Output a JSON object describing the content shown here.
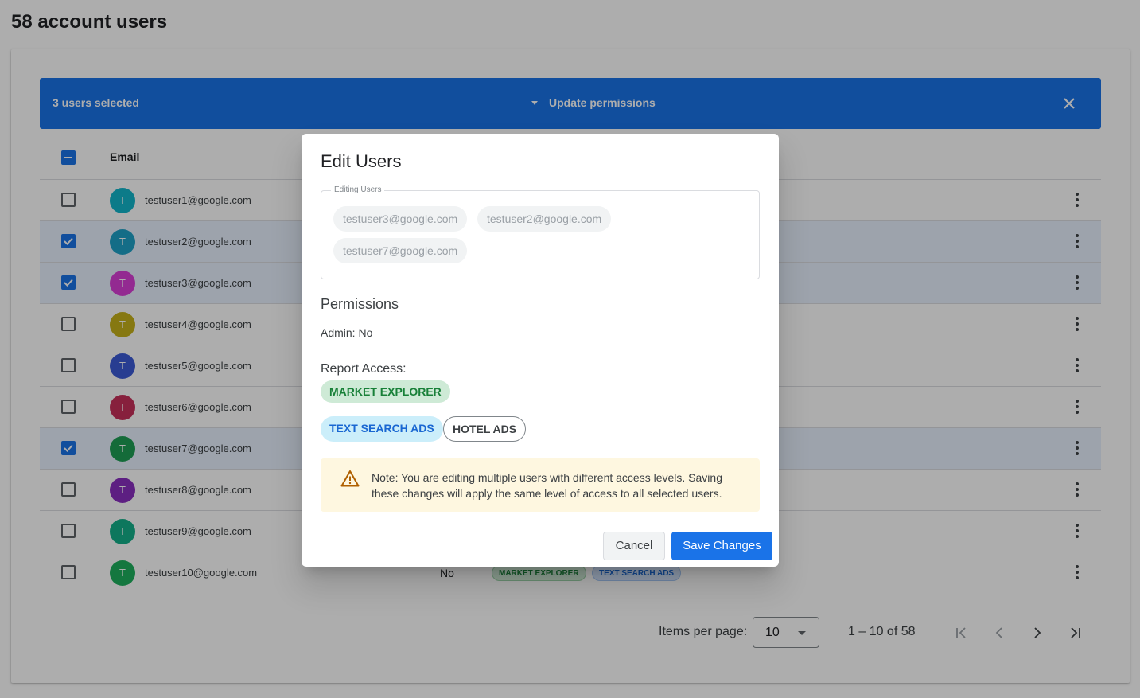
{
  "page": {
    "title": "58 account users"
  },
  "selection_bar": {
    "count_label": "3 users selected",
    "action_label": "Update permissions",
    "close_icon": "close-icon"
  },
  "table": {
    "email_header": "Email",
    "rows": [
      {
        "initial": "T",
        "email": "testuser1@google.com",
        "selected": false,
        "avatar_color": "#12b5cb"
      },
      {
        "initial": "T",
        "email": "testuser2@google.com",
        "selected": true,
        "avatar_color": "#1ea1c7"
      },
      {
        "initial": "T",
        "email": "testuser3@google.com",
        "selected": true,
        "avatar_color": "#d93fd6"
      },
      {
        "initial": "T",
        "email": "testuser4@google.com",
        "selected": false,
        "avatar_color": "#c6b21a"
      },
      {
        "initial": "T",
        "email": "testuser5@google.com",
        "selected": false,
        "avatar_color": "#3b5bd6"
      },
      {
        "initial": "T",
        "email": "testuser6@google.com",
        "selected": false,
        "avatar_color": "#c7305a"
      },
      {
        "initial": "T",
        "email": "testuser7@google.com",
        "selected": true,
        "avatar_color": "#1e9e55"
      },
      {
        "initial": "T",
        "email": "testuser8@google.com",
        "selected": false,
        "avatar_color": "#8a2ec0"
      },
      {
        "initial": "T",
        "email": "testuser9@google.com",
        "selected": false,
        "avatar_color": "#14b08a"
      },
      {
        "initial": "T",
        "email": "testuser10@google.com",
        "selected": false,
        "avatar_color": "#1eb05e",
        "admin": "No",
        "chips": [
          "MARKET EXPLORER",
          "TEXT SEARCH ADS"
        ]
      }
    ]
  },
  "pagination": {
    "items_per_page_label": "Items per page:",
    "items_per_page_value": "10",
    "range_label": "1 – 10 of 58"
  },
  "dialog": {
    "title": "Edit Users",
    "editing_legend": "Editing Users",
    "editing_users": [
      "testuser3@google.com",
      "testuser2@google.com",
      "testuser7@google.com"
    ],
    "permissions_heading": "Permissions",
    "admin_label": "Admin: No",
    "report_access_label": "Report Access:",
    "report_chips": [
      "MARKET EXPLORER",
      "TEXT SEARCH ADS",
      "HOTEL ADS"
    ],
    "note": "Note: You are editing multiple users with different access levels. Saving these changes will apply the same level of access to all selected users.",
    "cancel_label": "Cancel",
    "save_label": "Save Changes"
  },
  "colors": {
    "primary": "#1a73e8",
    "market_explorer_bg": "#ceead6",
    "market_explorer_fg": "#188038",
    "text_search_bg": "#d2e3fc",
    "text_search_fg": "#1967d2",
    "note_bg": "#fef7e0",
    "warn": "#b06000"
  }
}
